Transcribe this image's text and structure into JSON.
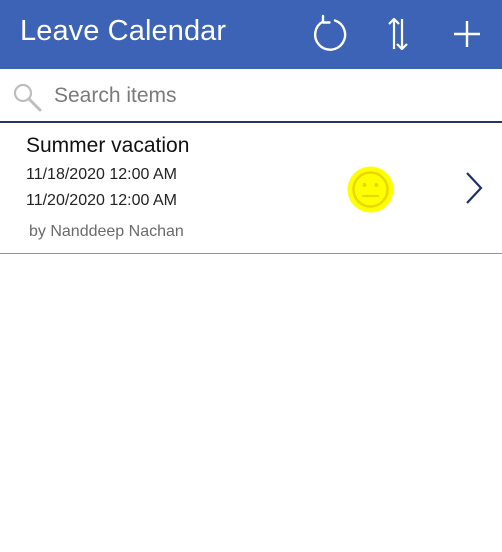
{
  "header": {
    "title": "Leave Calendar",
    "background_color": "#3c63b5",
    "actions": [
      {
        "icon": "refresh-icon"
      },
      {
        "icon": "sort-icon"
      },
      {
        "icon": "add-icon"
      }
    ]
  },
  "search": {
    "placeholder": "Search items",
    "value": "",
    "icon": "search-icon"
  },
  "items": [
    {
      "title": "Summer vacation",
      "start": "11/18/2020 12:00 AM",
      "end": "11/20/2020 12:00 AM",
      "author": "by Nanddeep Nachan",
      "status_icon": "neutral-face-icon",
      "status_color": "#ffff00",
      "nav_icon": "chevron-right-icon"
    }
  ]
}
